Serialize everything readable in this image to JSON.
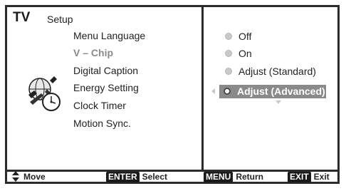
{
  "header": {
    "tv_label": "TV",
    "menu_title": "Setup"
  },
  "menu": {
    "items": [
      {
        "label": "Menu Language"
      },
      {
        "label": "V – Chip"
      },
      {
        "label": "Digital Caption"
      },
      {
        "label": "Energy Setting"
      },
      {
        "label": "Clock Timer"
      },
      {
        "label": "Motion Sync."
      }
    ]
  },
  "options": {
    "items": [
      {
        "label": "Off"
      },
      {
        "label": "On"
      },
      {
        "label": "Adjust (Standard)"
      },
      {
        "label": "Adjust (Advanced)"
      }
    ],
    "selected_index": 3
  },
  "footer": {
    "move_label": "Move",
    "enter_key": "ENTER",
    "select_label": "Select",
    "menu_key": "MENU",
    "return_label": "Return",
    "exit_key": "EXIT",
    "exit_label": "Exit"
  },
  "icons": {
    "menu_icon": "settings-clock-icon",
    "move_icon": "up-down-arrows-icon",
    "left_arrow": "left-arrow-icon",
    "down_arrow": "down-arrow-icon"
  },
  "colors": {
    "border": "#2b2b2b",
    "highlight": "#8a8a8a",
    "dimmed_text": "#8a8a8a",
    "key_bg": "#1a1a1a"
  }
}
